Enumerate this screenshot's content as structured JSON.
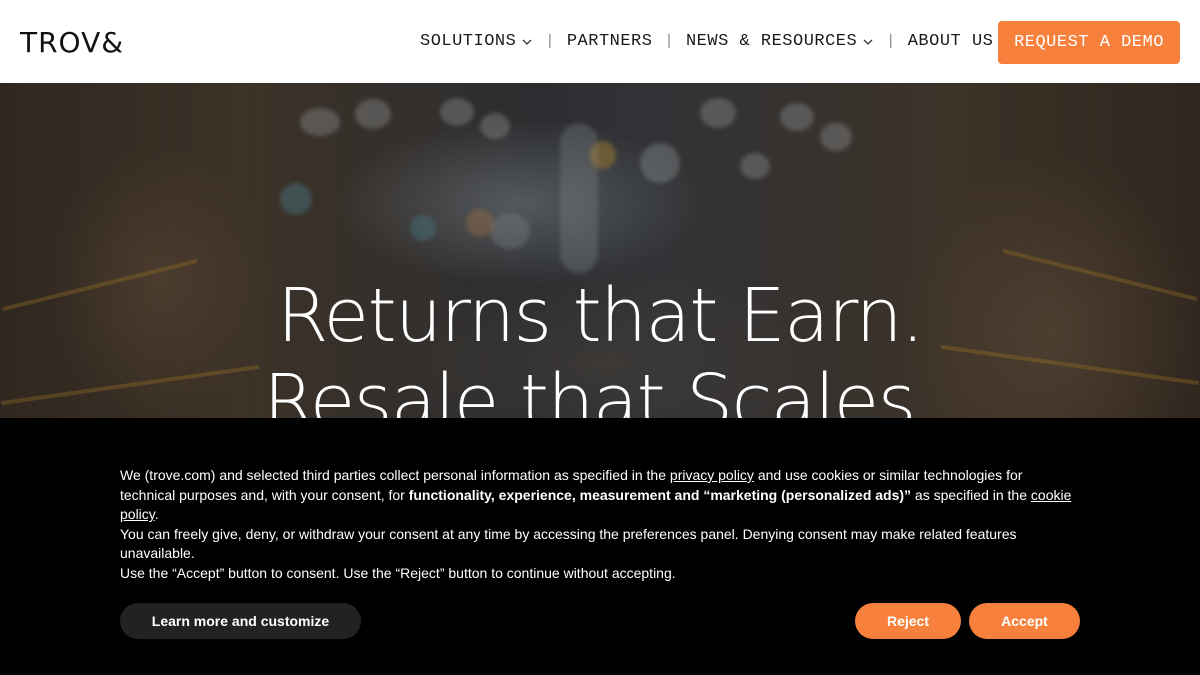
{
  "brand": {
    "logo_text": "TROV&",
    "accent_color": "#f7803c"
  },
  "nav": {
    "items": [
      {
        "label": "SOLUTIONS",
        "has_dropdown": true
      },
      {
        "label": "PARTNERS",
        "has_dropdown": false
      },
      {
        "label": "NEWS & RESOURCES",
        "has_dropdown": true
      },
      {
        "label": "ABOUT US",
        "has_dropdown": false
      }
    ],
    "cta_label": "REQUEST A DEMO"
  },
  "hero": {
    "line1": "Returns that Earn.",
    "line2": "Resale that Scales."
  },
  "cookie": {
    "p1_a": "We (trove.com) and selected third parties collect personal information as specified in the ",
    "privacy_link": "privacy policy",
    "p1_b": " and use cookies or similar technologies for technical purposes and, with your consent, for ",
    "p1_bold": "functionality, experience, measurement and “marketing (personalized ads)”",
    "p1_c": " as specified in the ",
    "cookie_link": "cookie policy",
    "p1_d": ".",
    "p2": "You can freely give, deny, or withdraw your consent at any time by accessing the preferences panel. Denying consent may make related features unavailable.",
    "p3": "Use the “Accept” button to consent. Use the “Reject” button to continue without accepting.",
    "learn_label": "Learn more and customize",
    "reject_label": "Reject",
    "accept_label": "Accept"
  }
}
